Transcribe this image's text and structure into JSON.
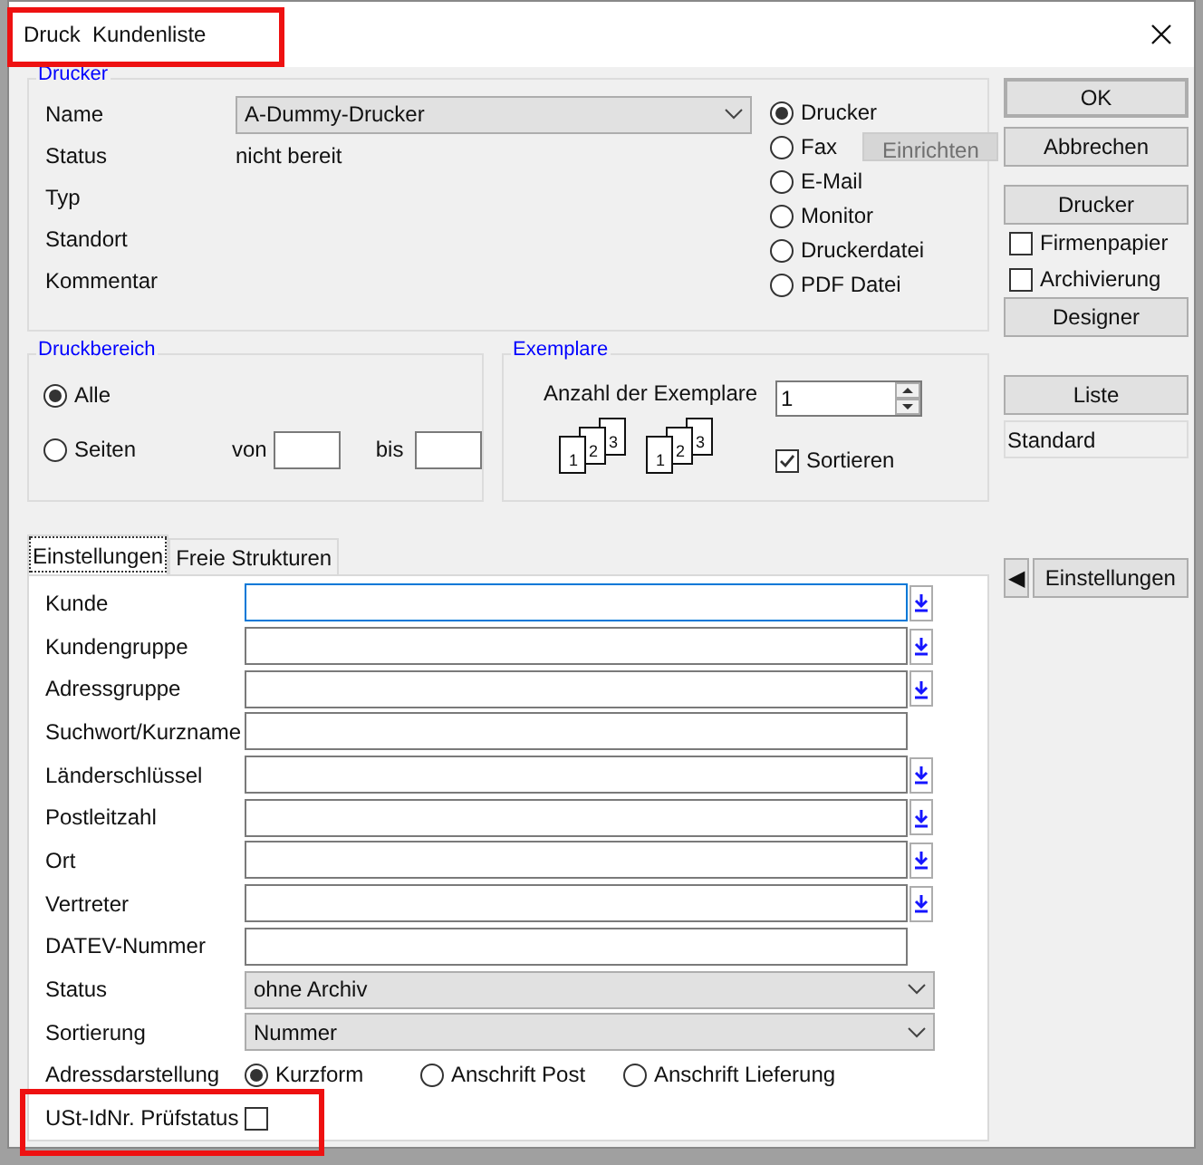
{
  "window": {
    "title": "Druck  Kundenliste"
  },
  "drucker": {
    "legend": "Drucker",
    "fields": [
      {
        "label": "Name",
        "kind": "select",
        "value": "A-Dummy-Drucker"
      },
      {
        "label": "Status",
        "kind": "text",
        "value": "nicht bereit"
      },
      {
        "label": "Typ",
        "kind": "text"
      },
      {
        "label": "Standort",
        "kind": "text"
      },
      {
        "label": "Kommentar",
        "kind": "text"
      }
    ],
    "outputs": [
      {
        "label": "Drucker",
        "selected": true
      },
      {
        "label": "Fax",
        "selected": false,
        "button": "Einrichten"
      },
      {
        "label": "E-Mail",
        "selected": false
      },
      {
        "label": "Monitor",
        "selected": false
      },
      {
        "label": "Druckerdatei",
        "selected": false
      },
      {
        "label": "PDF Datei",
        "selected": false
      }
    ]
  },
  "side": {
    "ok": "OK",
    "cancel": "Abbrechen",
    "printer": "Drucker",
    "checks": [
      {
        "label": "Firmenpapier",
        "checked": false
      },
      {
        "label": "Archivierung",
        "checked": false
      }
    ],
    "designer": "Designer",
    "list": "Liste",
    "list_value": "Standard",
    "settings": "Einstellungen",
    "settings_arrow": "◀"
  },
  "druckbereich": {
    "legend": "Druckbereich",
    "options": [
      {
        "label": "Alle",
        "selected": true
      },
      {
        "label": "Seiten",
        "selected": false
      }
    ],
    "from": "von",
    "to": "bis"
  },
  "exemplare": {
    "legend": "Exemplare",
    "count_label": "Anzahl der Exemplare",
    "count": "1",
    "stacks": [
      [
        "1",
        "2",
        "3"
      ],
      [
        "1",
        "2",
        "3"
      ]
    ],
    "sort": {
      "label": "Sortieren",
      "checked": true
    }
  },
  "tabs": [
    {
      "label": "Einstellungen",
      "selected": true
    },
    {
      "label": "Freie Strukturen",
      "selected": false
    }
  ],
  "form": [
    {
      "label": "Kunde",
      "kind": "lookup",
      "focused": true
    },
    {
      "label": "Kundengruppe",
      "kind": "lookup",
      "focused": false
    },
    {
      "label": "Adressgruppe",
      "kind": "lookup",
      "focused": false
    },
    {
      "label": "Suchwort/Kurzname",
      "kind": "input",
      "focused": false
    },
    {
      "label": "Länderschlüssel",
      "kind": "lookup",
      "focused": false
    },
    {
      "label": "Postleitzahl",
      "kind": "lookup",
      "focused": false
    },
    {
      "label": "Ort",
      "kind": "lookup",
      "focused": false
    },
    {
      "label": "Vertreter",
      "kind": "lookup",
      "focused": false
    },
    {
      "label": "DATEV-Nummer",
      "kind": "input",
      "focused": false
    },
    {
      "label": "Status",
      "kind": "select",
      "value": "ohne Archiv"
    },
    {
      "label": "Sortierung",
      "kind": "select",
      "value": "Nummer"
    },
    {
      "label": "Adressdarstellung",
      "kind": "radios",
      "options": [
        {
          "label": "Kurzform",
          "selected": true
        },
        {
          "label": "Anschrift Post",
          "selected": false
        },
        {
          "label": "Anschrift Lieferung",
          "selected": false
        }
      ]
    },
    {
      "label": "USt-IdNr. Prüfstatus",
      "kind": "check",
      "checked": false
    }
  ]
}
